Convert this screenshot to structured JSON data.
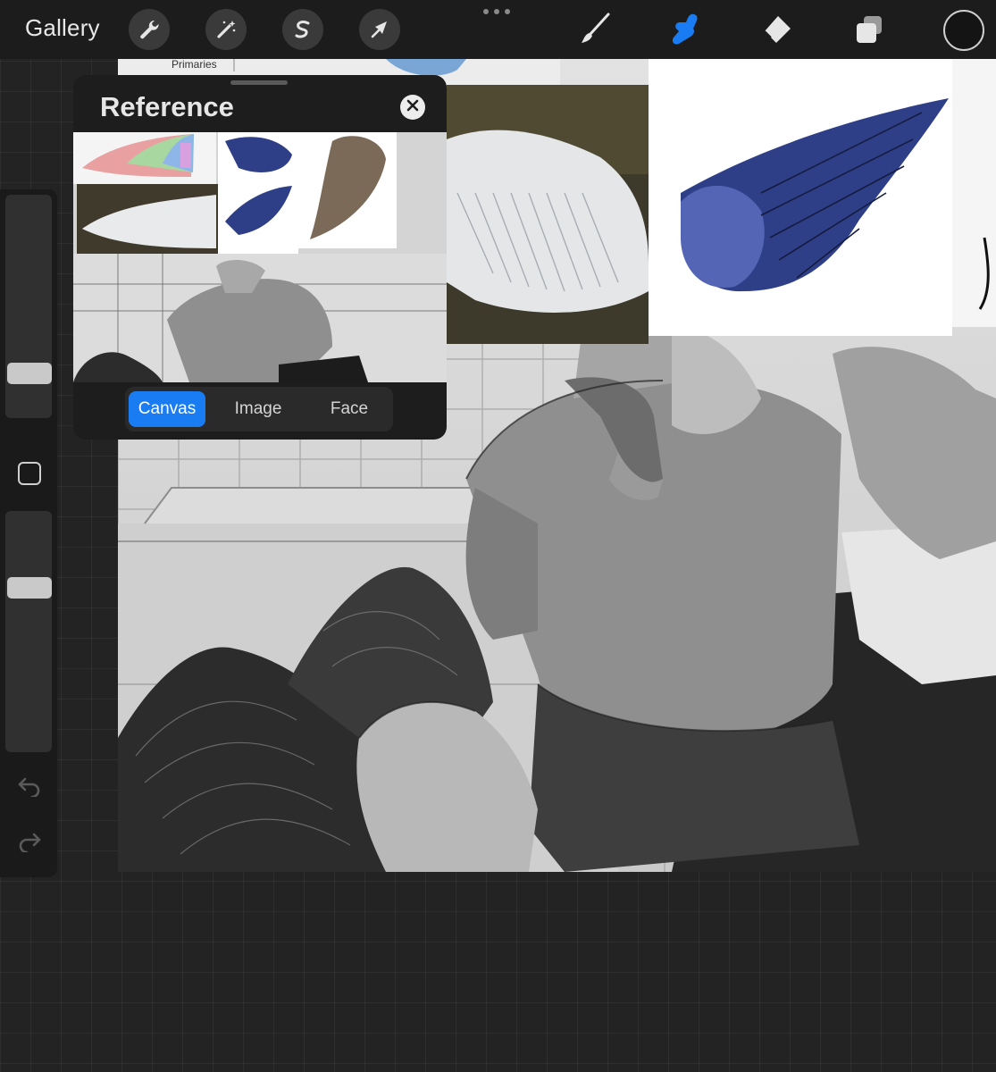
{
  "app": {
    "gallery_label": "Gallery"
  },
  "toolbar": {
    "left_tools": [
      "actions-icon",
      "adjustments-icon",
      "selection-icon",
      "transform-icon"
    ],
    "right_tools": [
      "brush-icon",
      "smudge-icon",
      "eraser-icon",
      "layers-icon"
    ],
    "active_tool": "smudge-icon",
    "active_color": "#1a7cf2",
    "current_color": "#141414"
  },
  "sidebar": {
    "brush_size": 0.17,
    "opacity": 0.7
  },
  "canvas": {
    "diagram_label": "Primaries"
  },
  "reference": {
    "title": "Reference",
    "tabs": [
      "Canvas",
      "Image",
      "Face"
    ],
    "selected_tab": "Canvas"
  }
}
